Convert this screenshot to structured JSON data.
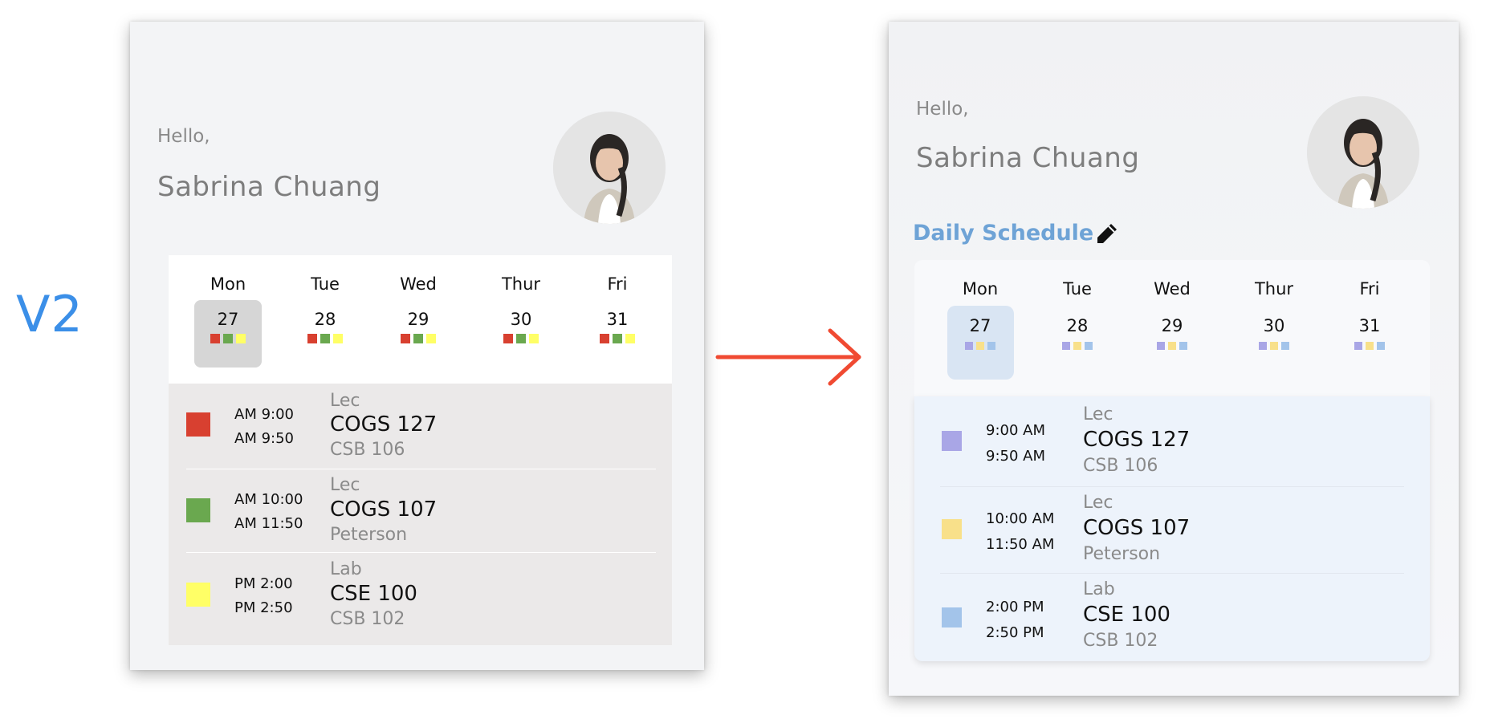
{
  "version_label": "V2",
  "before": {
    "greeting": "Hello,",
    "user_name": "Sabrina Chuang",
    "days": [
      {
        "name": "Mon",
        "date": "27",
        "selected": true
      },
      {
        "name": "Tue",
        "date": "28"
      },
      {
        "name": "Wed",
        "date": "29"
      },
      {
        "name": "Thur",
        "date": "30"
      },
      {
        "name": "Fri",
        "date": "31"
      }
    ],
    "dot_colors": [
      "#d84030",
      "#6aa84f",
      "#ffff66"
    ],
    "events": [
      {
        "color": "#d84030",
        "start": "AM 9:00",
        "end": "AM 9:50",
        "type": "Lec",
        "course": "COGS 127",
        "location": "CSB 106"
      },
      {
        "color": "#6aa84f",
        "start": "AM 10:00",
        "end": "AM 11:50",
        "type": "Lec",
        "course": "COGS 107",
        "location": "Peterson"
      },
      {
        "color": "#ffff66",
        "start": "PM 2:00",
        "end": "PM 2:50",
        "type": "Lab",
        "course": "CSE 100",
        "location": "CSB 102"
      }
    ]
  },
  "after": {
    "greeting": "Hello,",
    "user_name": "Sabrina Chuang",
    "schedule_title": "Daily Schedule",
    "days": [
      {
        "name": "Mon",
        "date": "27",
        "selected": true
      },
      {
        "name": "Tue",
        "date": "28"
      },
      {
        "name": "Wed",
        "date": "29"
      },
      {
        "name": "Thur",
        "date": "30"
      },
      {
        "name": "Fri",
        "date": "31"
      }
    ],
    "dot_colors": [
      "#a9a6e6",
      "#f8e08a",
      "#a3c4ea"
    ],
    "events": [
      {
        "color": "#a9a6e6",
        "start": "9:00 AM",
        "end": "9:50 AM",
        "type": "Lec",
        "course": "COGS 127",
        "location": "CSB 106"
      },
      {
        "color": "#f8e08a",
        "start": "10:00 AM",
        "end": "11:50  AM",
        "type": "Lec",
        "course": "COGS 107",
        "location": "Peterson"
      },
      {
        "color": "#a3c4ea",
        "start": "2:00 PM",
        "end": "2:50 PM",
        "type": "Lab",
        "course": "CSE 100",
        "location": "CSB 102"
      }
    ]
  },
  "icons": {
    "arrow": "arrow-right-icon",
    "pencil": "pencil-icon",
    "arrow_color": "#f04a32"
  }
}
